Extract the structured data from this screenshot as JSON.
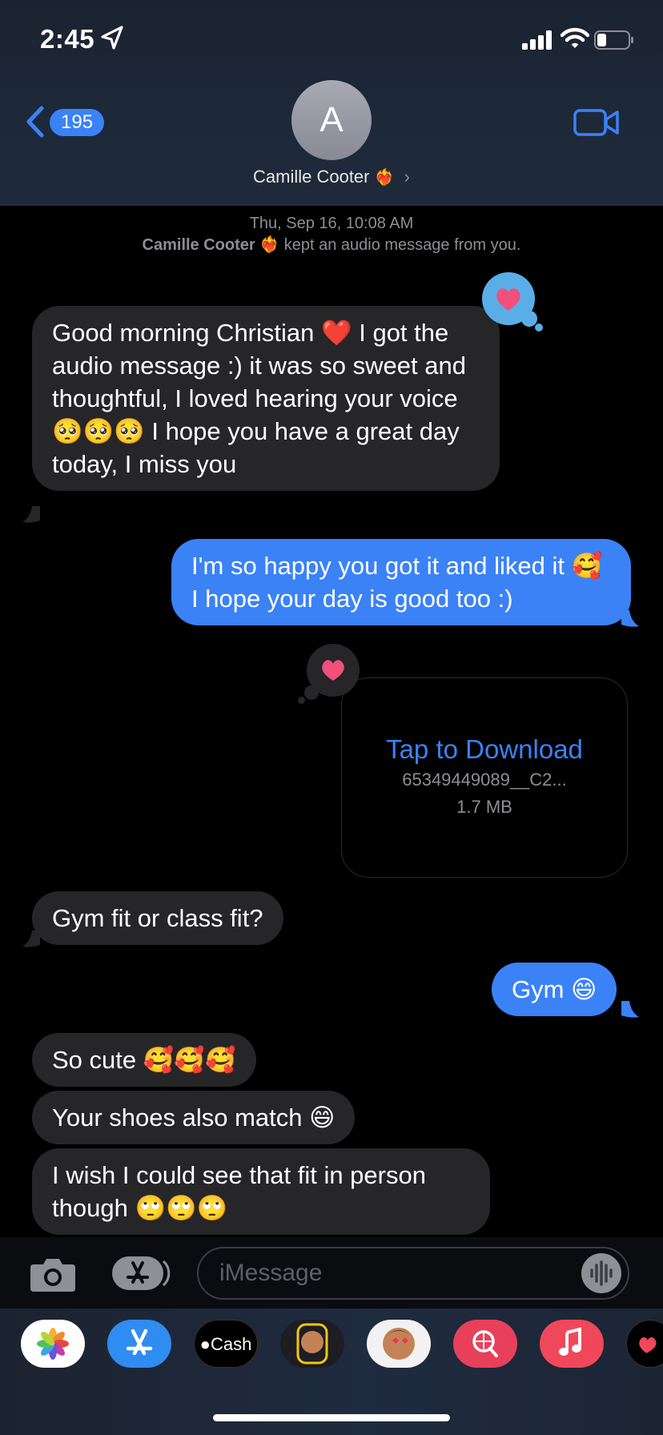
{
  "status_bar": {
    "time": "2:45"
  },
  "header": {
    "back_count": "195",
    "avatar_initial": "A",
    "contact_name": "Camille Cooter",
    "contact_emoji": "❤️‍🔥",
    "chevron": "›"
  },
  "info": {
    "timestamp_day": "Thu, Sep 16,",
    "timestamp_time": "10:08 AM",
    "kept_name": "Camille Cooter",
    "kept_emoji": "❤️‍🔥",
    "kept_text": "kept an audio message from you."
  },
  "messages": {
    "m1": {
      "part1": "Good morning Christian ",
      "emoji1": "❤️",
      "part2": " I got the audio message :) it was so sweet and thoughtful, I loved hearing your voice ",
      "emoji2": "🥺🥺🥺",
      "part3": " I hope you have a great day today, I miss you"
    },
    "m2": {
      "part1": "I'm so happy you got it and liked it ",
      "emoji1": "🥰",
      "part2": " I hope your day is good too :)"
    },
    "m3": {
      "tap": "Tap to Download",
      "filename": "65349449089__C2...",
      "size": "1.7 MB"
    },
    "m4": {
      "text": "Gym fit or class fit?"
    },
    "m5": {
      "text": "Gym ",
      "emoji": "😄"
    },
    "m6": {
      "text": "So cute ",
      "emoji": "🥰🥰🥰"
    },
    "m7": {
      "text": "Your shoes also match ",
      "emoji": "😄"
    },
    "m8": {
      "text": "I wish I could see that fit in person though ",
      "emoji": "🙄🙄🙄"
    }
  },
  "composer": {
    "placeholder": "iMessage"
  },
  "app_drawer": {
    "cash_label": "Cash"
  },
  "colors": {
    "outgoing": "#3b82f6",
    "incoming": "#262628",
    "tapback_heart": "#f0507a"
  }
}
